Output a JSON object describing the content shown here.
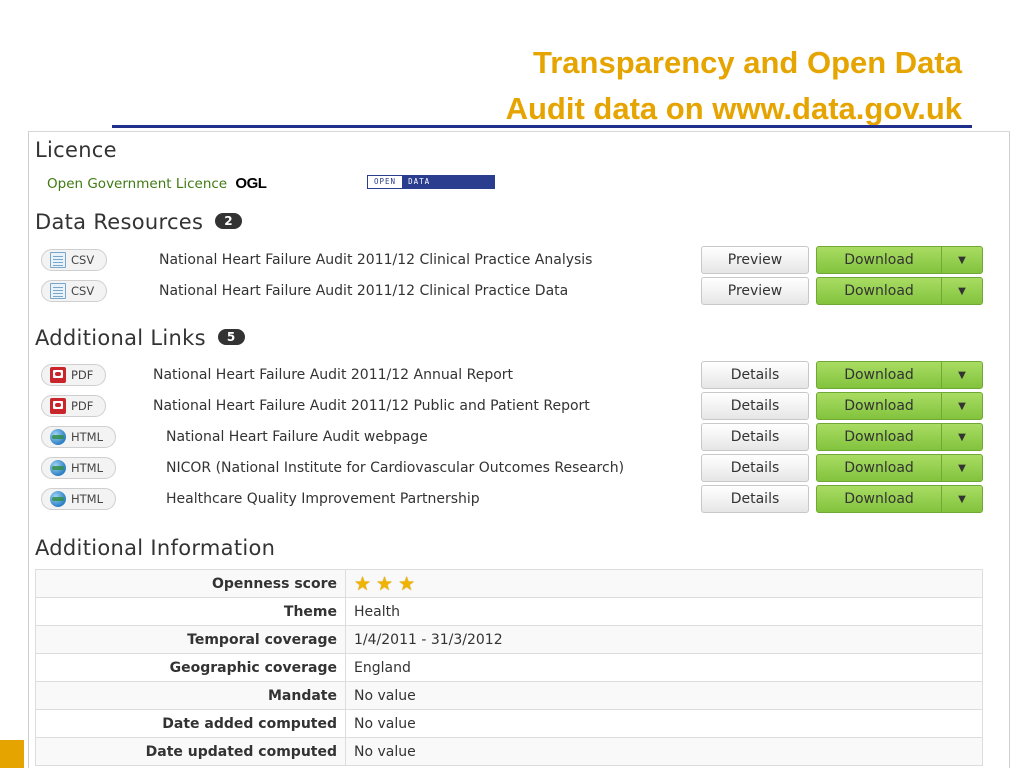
{
  "slide": {
    "title_line1": "Transparency and Open Data",
    "title_line2": "Audit data on www.data.gov.uk"
  },
  "licence": {
    "heading": "Licence",
    "link_text": "Open Government Licence",
    "ogl_mark": "OGL",
    "badge_left": "OPEN",
    "badge_right": "DATA"
  },
  "data_resources": {
    "heading": "Data Resources",
    "count": "2",
    "items": [
      {
        "format": "CSV",
        "icon": "csv-icon",
        "title": "National Heart Failure Audit 2011/12 Clinical Practice Analysis",
        "action": "Preview",
        "download": "Download"
      },
      {
        "format": "CSV",
        "icon": "csv-icon",
        "title": "National Heart Failure Audit 2011/12 Clinical Practice Data",
        "action": "Preview",
        "download": "Download"
      }
    ]
  },
  "additional_links": {
    "heading": "Additional Links",
    "count": "5",
    "items": [
      {
        "format": "PDF",
        "icon": "pdf-icon",
        "title": "National Heart Failure Audit 2011/12 Annual Report",
        "action": "Details",
        "download": "Download"
      },
      {
        "format": "PDF",
        "icon": "pdf-icon",
        "title": "National Heart Failure Audit 2011/12 Public and Patient Report",
        "action": "Details",
        "download": "Download"
      },
      {
        "format": "HTML",
        "icon": "globe-icon",
        "title": "National Heart Failure Audit webpage",
        "action": "Details",
        "download": "Download"
      },
      {
        "format": "HTML",
        "icon": "globe-icon",
        "title": "NICOR (National Institute for Cardiovascular Outcomes Research)",
        "action": "Details",
        "download": "Download"
      },
      {
        "format": "HTML",
        "icon": "globe-icon",
        "title": "Healthcare Quality Improvement Partnership",
        "action": "Details",
        "download": "Download"
      }
    ]
  },
  "additional_info": {
    "heading": "Additional Information",
    "openness_label": "Openness score",
    "openness_stars": 3,
    "rows": [
      {
        "key": "Theme",
        "value": "Health"
      },
      {
        "key": "Temporal coverage",
        "value": "1/4/2011 - 31/3/2012"
      },
      {
        "key": "Geographic coverage",
        "value": "England"
      },
      {
        "key": "Mandate",
        "value": "No value"
      },
      {
        "key": "Date added computed",
        "value": "No value"
      },
      {
        "key": "Date updated computed",
        "value": "No value"
      }
    ]
  },
  "colors": {
    "title": "#e5a400",
    "underline": "#1f2f8a",
    "download_green": "#8cc944",
    "licence_link": "#3f7a12"
  }
}
